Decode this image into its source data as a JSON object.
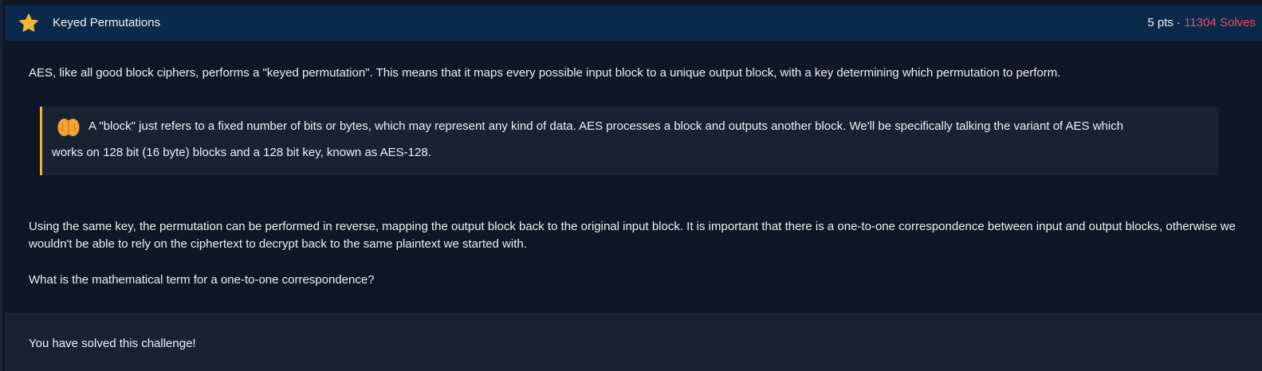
{
  "header": {
    "title": "Keyed Permutations",
    "points": "5 pts · ",
    "solves": "11304 Solves"
  },
  "content": {
    "paragraph1": "AES, like all good block ciphers, performs a \"keyed permutation\". This means that it maps every possible input block to a unique output block, with a key determining which permutation to perform.",
    "callout_line1": "A \"block\" just refers to a fixed number of bits or bytes, which may represent any kind of data. AES processes a block and outputs another block. We'll be specifically talking the variant of AES which",
    "callout_line2": "works on 128 bit (16 byte) blocks and a 128 bit key, known as AES-128.",
    "paragraph2": "Using the same key, the permutation can be performed in reverse, mapping the output block back to the original input block. It is important that there is a one-to-one correspondence between input and output blocks, otherwise we wouldn't be able to rely on the ciphertext to decrypt back to the same plaintext we started with.",
    "paragraph3": "What is the mathematical term for a one-to-one correspondence?"
  },
  "footer": {
    "status": "You have solved this challenge!"
  },
  "colors": {
    "header_bg": "#0a2a4b",
    "page_bg": "#0f1626",
    "accent_star": "#f3b531",
    "solves_red": "#f04a5e",
    "callout_border": "#f3b531"
  },
  "icons": {
    "star": "star-icon",
    "brain": "brain-icon"
  }
}
